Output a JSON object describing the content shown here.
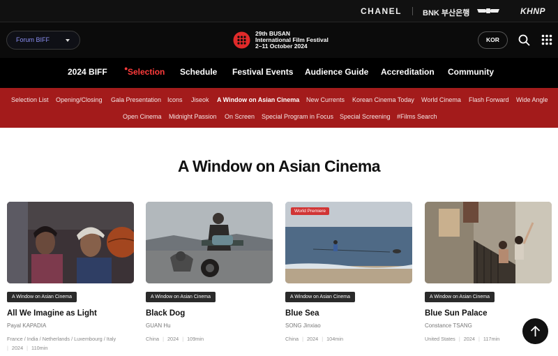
{
  "sponsors": {
    "chanel": "CHANEL",
    "bnk": "BNK 부산은행",
    "genesis": "genesis-logo-icon",
    "khnp": "KHNP"
  },
  "header": {
    "forum_select": "Forum BIFF",
    "logo_line1": "29th BUSAN",
    "logo_line2": "International Film Festival",
    "logo_line3": "2–11 October 2024",
    "lang_button": "KOR"
  },
  "main_nav": [
    {
      "label": "2024 BIFF"
    },
    {
      "label": "Selection",
      "active": true
    },
    {
      "label": "Schedule"
    },
    {
      "label": "Festival Events"
    },
    {
      "label": "Audience Guide"
    },
    {
      "label": "Accreditation"
    },
    {
      "label": "Community"
    }
  ],
  "sub_nav": [
    {
      "label": "Selection List"
    },
    {
      "label": "Opening/Closing"
    },
    {
      "label": "Gala Presentation"
    },
    {
      "label": "Icons"
    },
    {
      "label": "Jiseok"
    },
    {
      "label": "A Window on Asian Cinema",
      "active": true
    },
    {
      "label": "New Currents"
    },
    {
      "label": "Korean Cinema Today"
    },
    {
      "label": "World Cinema"
    },
    {
      "label": "Flash Forward"
    },
    {
      "label": "Wide Angle"
    },
    {
      "label": "Open Cinema"
    },
    {
      "label": "Midnight Passion"
    },
    {
      "label": "On Screen"
    },
    {
      "label": "Special Program in Focus"
    },
    {
      "label": "Special Screening"
    },
    {
      "label": "#Films Search"
    }
  ],
  "page_title": "A Window on Asian Cinema",
  "films": [
    {
      "tag": "A Window on Asian Cinema",
      "title": "All We Imagine as Light",
      "director": "Payal KAPADIA",
      "country": "France / India / Netherlands / Luxembourg / Italy",
      "year": "2024",
      "runtime": "110min"
    },
    {
      "tag": "A Window on Asian Cinema",
      "title": "Black Dog",
      "director": "GUAN Hu",
      "country": "China",
      "year": "2024",
      "runtime": "109min"
    },
    {
      "badge": "World Premiere",
      "tag": "A Window on Asian Cinema",
      "title": "Blue Sea",
      "director": "SONG Jinxiao",
      "country": "China",
      "year": "2024",
      "runtime": "104min"
    },
    {
      "tag": "A Window on Asian Cinema",
      "title": "Blue Sun Palace",
      "director": "Constance TSANG",
      "country": "United States",
      "year": "2024",
      "runtime": "117min"
    }
  ],
  "colors": {
    "accent_red": "#a31b1b",
    "active_nav": "#ff3b3b",
    "premiere_badge": "#d13535"
  }
}
